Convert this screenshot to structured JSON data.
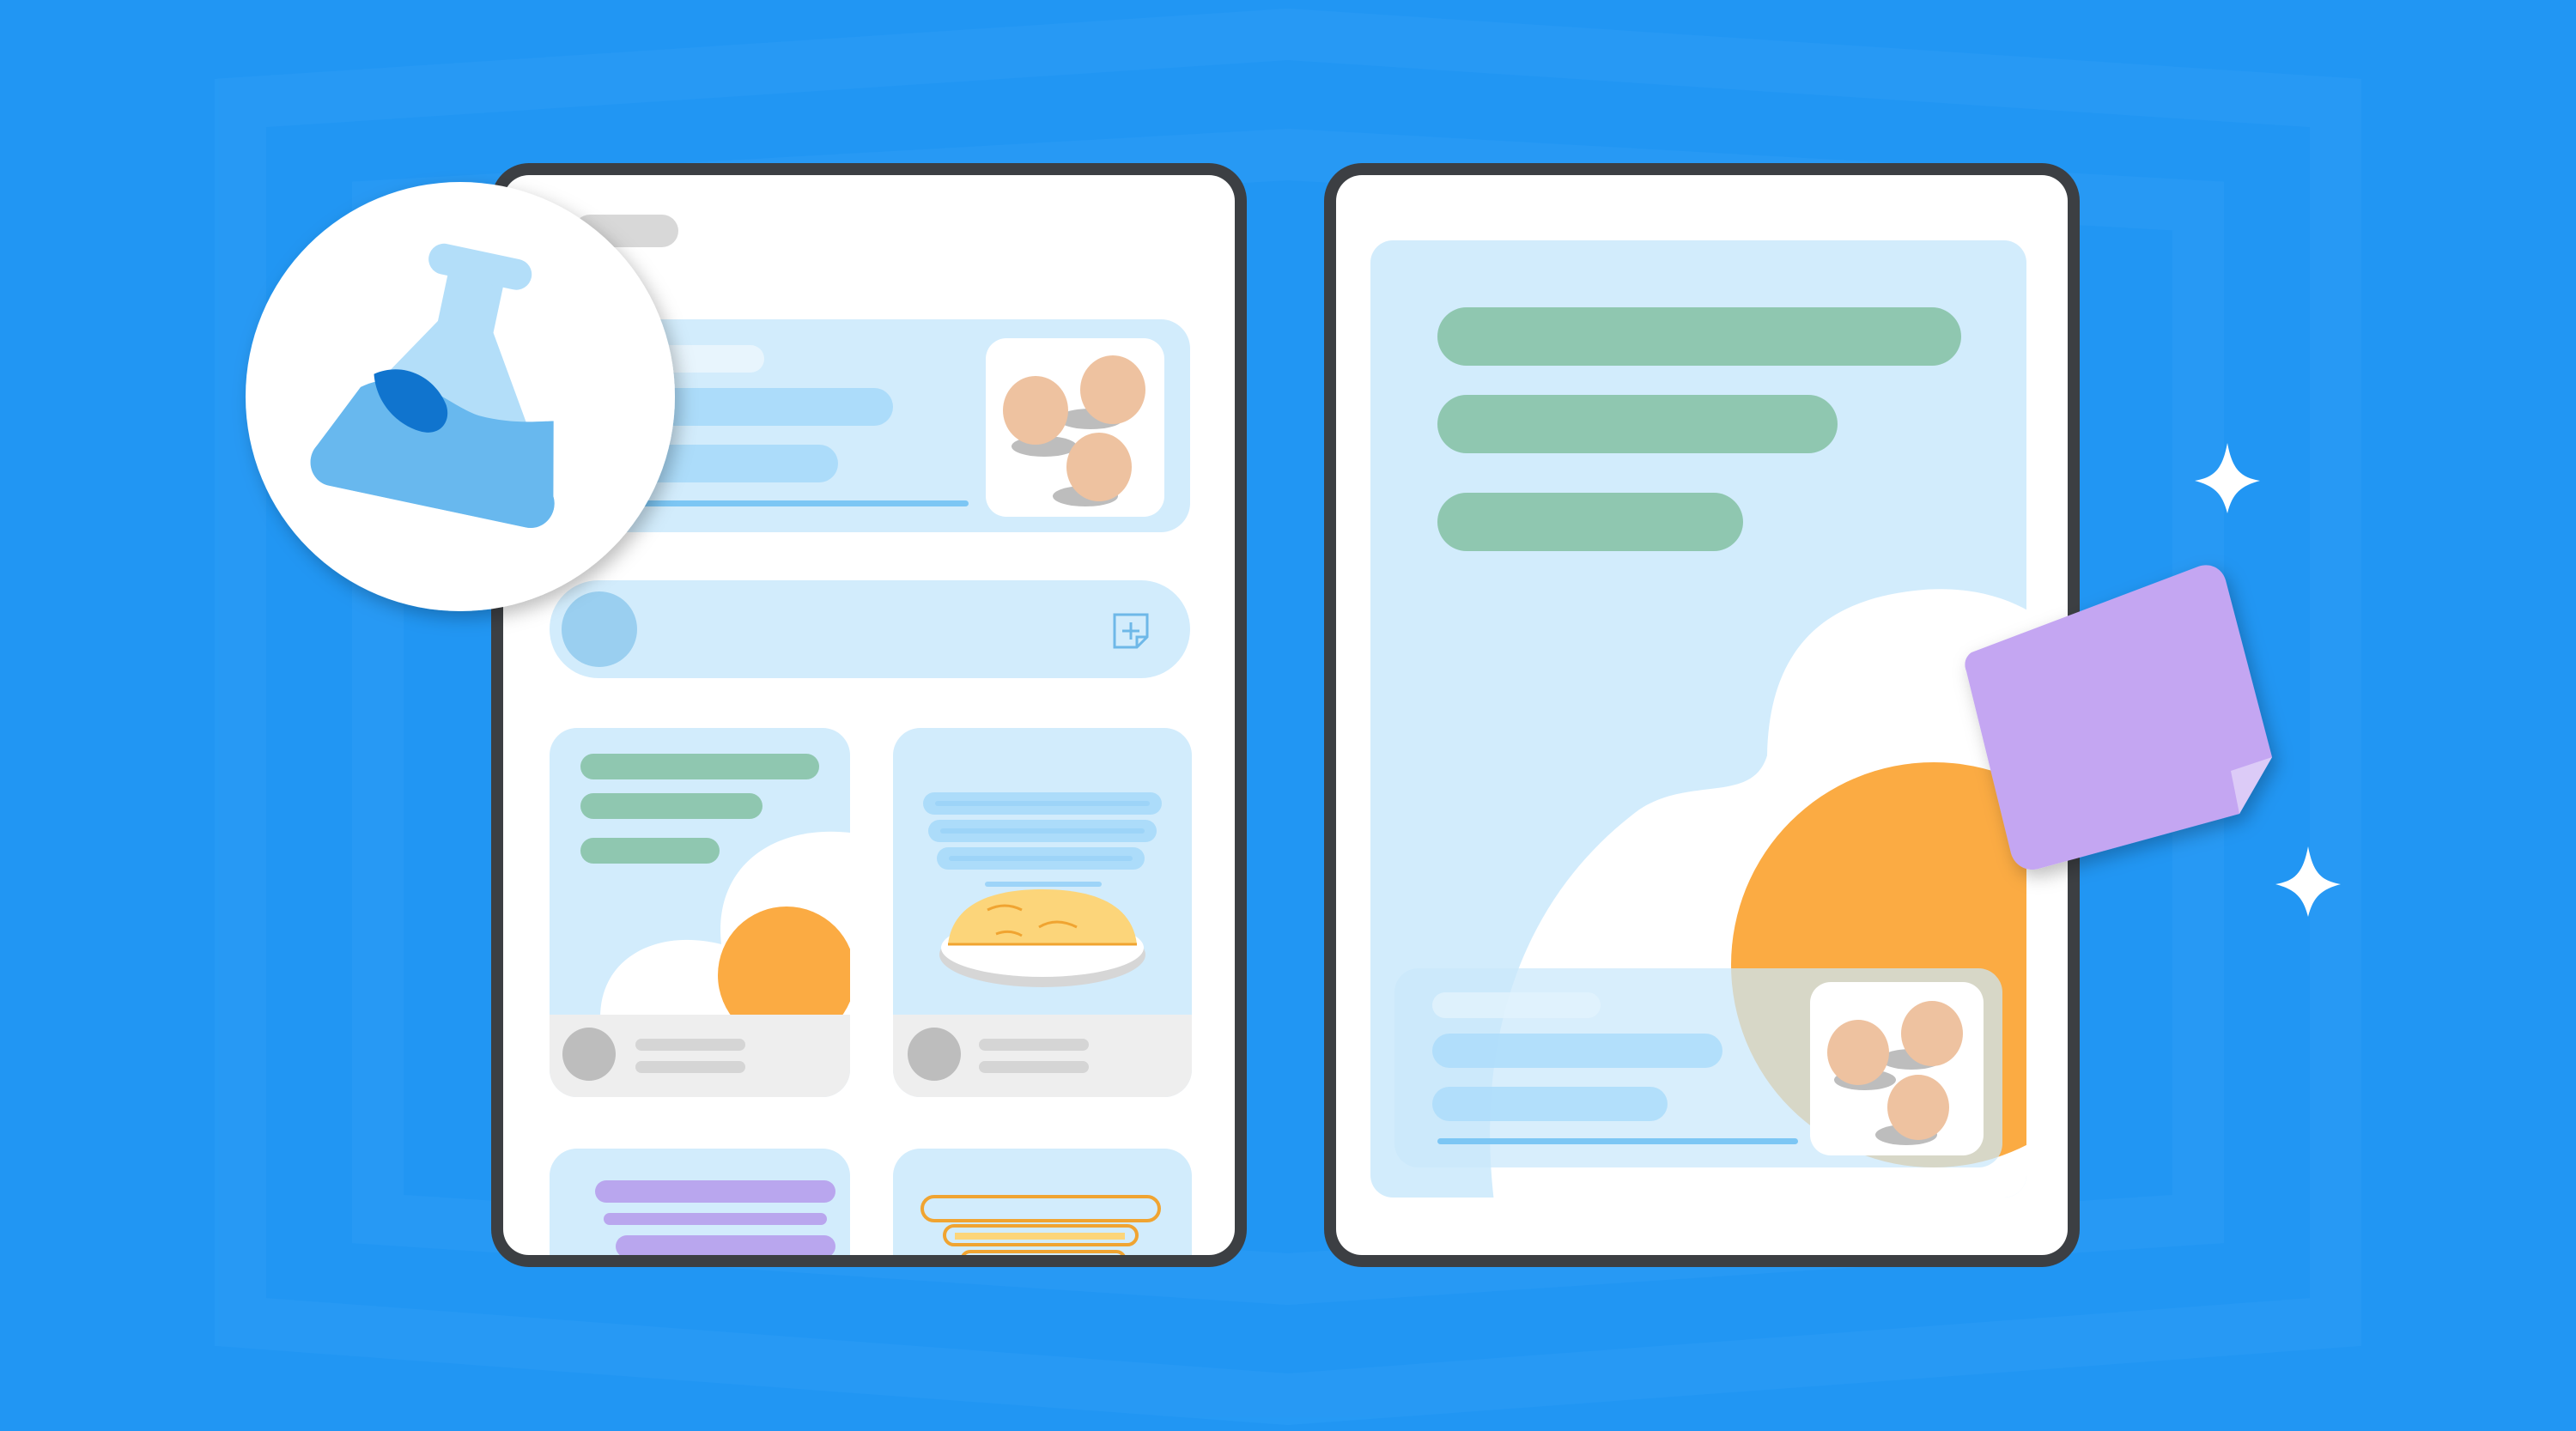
{
  "scene": {
    "colors": {
      "background": "#2196F3",
      "background_pattern": "#2A9BF5",
      "device_frame": "#3C3F43",
      "screen": "#FFFFFF",
      "card_light_blue": "#D2ECFC",
      "bar_blue": "#ACDCFA",
      "bar_green": "#8FC7B0",
      "progress_line": "#7CC6F4",
      "egg": "#EEC2A0",
      "egg_shadow": "#BDBDBD",
      "sun_orange": "#FBAB43",
      "cloud_white": "#FFFFFF",
      "avatar_grey": "#BDBDBD",
      "footer_grey": "#EEEEEE",
      "text_line_grey": "#D5D5D5",
      "avatar_blue": "#9ACFF0",
      "purple_text_bar": "#B9A6EE",
      "pancake_yellow": "#FCD57A",
      "pancake_edge": "#F0A431",
      "plate_grey": "#E0E0E0",
      "flask_light": "#B3DEF9",
      "flask_liquid": "#68B8EE",
      "flask_dark_liquid": "#1074CE",
      "note_purple": "#C4A6F2",
      "note_fold": "#DCCBF7",
      "sparkle": "#FFFFFF"
    },
    "icons": {
      "badge": "flask-icon",
      "composer_action": "add-note-icon",
      "sticky_note": "sticky-note-icon",
      "sparkles": "sparkle-icon"
    }
  }
}
